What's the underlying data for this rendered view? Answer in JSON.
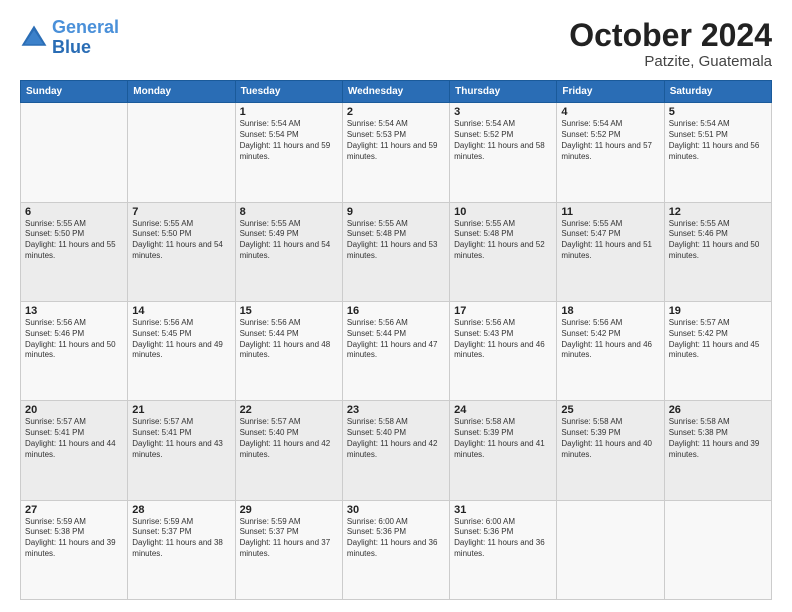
{
  "header": {
    "logo_line1": "General",
    "logo_line2": "Blue",
    "month": "October 2024",
    "location": "Patzite, Guatemala"
  },
  "weekdays": [
    "Sunday",
    "Monday",
    "Tuesday",
    "Wednesday",
    "Thursday",
    "Friday",
    "Saturday"
  ],
  "weeks": [
    [
      {
        "day": "",
        "sunrise": "",
        "sunset": "",
        "daylight": ""
      },
      {
        "day": "",
        "sunrise": "",
        "sunset": "",
        "daylight": ""
      },
      {
        "day": "1",
        "sunrise": "Sunrise: 5:54 AM",
        "sunset": "Sunset: 5:54 PM",
        "daylight": "Daylight: 11 hours and 59 minutes."
      },
      {
        "day": "2",
        "sunrise": "Sunrise: 5:54 AM",
        "sunset": "Sunset: 5:53 PM",
        "daylight": "Daylight: 11 hours and 59 minutes."
      },
      {
        "day": "3",
        "sunrise": "Sunrise: 5:54 AM",
        "sunset": "Sunset: 5:52 PM",
        "daylight": "Daylight: 11 hours and 58 minutes."
      },
      {
        "day": "4",
        "sunrise": "Sunrise: 5:54 AM",
        "sunset": "Sunset: 5:52 PM",
        "daylight": "Daylight: 11 hours and 57 minutes."
      },
      {
        "day": "5",
        "sunrise": "Sunrise: 5:54 AM",
        "sunset": "Sunset: 5:51 PM",
        "daylight": "Daylight: 11 hours and 56 minutes."
      }
    ],
    [
      {
        "day": "6",
        "sunrise": "Sunrise: 5:55 AM",
        "sunset": "Sunset: 5:50 PM",
        "daylight": "Daylight: 11 hours and 55 minutes."
      },
      {
        "day": "7",
        "sunrise": "Sunrise: 5:55 AM",
        "sunset": "Sunset: 5:50 PM",
        "daylight": "Daylight: 11 hours and 54 minutes."
      },
      {
        "day": "8",
        "sunrise": "Sunrise: 5:55 AM",
        "sunset": "Sunset: 5:49 PM",
        "daylight": "Daylight: 11 hours and 54 minutes."
      },
      {
        "day": "9",
        "sunrise": "Sunrise: 5:55 AM",
        "sunset": "Sunset: 5:48 PM",
        "daylight": "Daylight: 11 hours and 53 minutes."
      },
      {
        "day": "10",
        "sunrise": "Sunrise: 5:55 AM",
        "sunset": "Sunset: 5:48 PM",
        "daylight": "Daylight: 11 hours and 52 minutes."
      },
      {
        "day": "11",
        "sunrise": "Sunrise: 5:55 AM",
        "sunset": "Sunset: 5:47 PM",
        "daylight": "Daylight: 11 hours and 51 minutes."
      },
      {
        "day": "12",
        "sunrise": "Sunrise: 5:55 AM",
        "sunset": "Sunset: 5:46 PM",
        "daylight": "Daylight: 11 hours and 50 minutes."
      }
    ],
    [
      {
        "day": "13",
        "sunrise": "Sunrise: 5:56 AM",
        "sunset": "Sunset: 5:46 PM",
        "daylight": "Daylight: 11 hours and 50 minutes."
      },
      {
        "day": "14",
        "sunrise": "Sunrise: 5:56 AM",
        "sunset": "Sunset: 5:45 PM",
        "daylight": "Daylight: 11 hours and 49 minutes."
      },
      {
        "day": "15",
        "sunrise": "Sunrise: 5:56 AM",
        "sunset": "Sunset: 5:44 PM",
        "daylight": "Daylight: 11 hours and 48 minutes."
      },
      {
        "day": "16",
        "sunrise": "Sunrise: 5:56 AM",
        "sunset": "Sunset: 5:44 PM",
        "daylight": "Daylight: 11 hours and 47 minutes."
      },
      {
        "day": "17",
        "sunrise": "Sunrise: 5:56 AM",
        "sunset": "Sunset: 5:43 PM",
        "daylight": "Daylight: 11 hours and 46 minutes."
      },
      {
        "day": "18",
        "sunrise": "Sunrise: 5:56 AM",
        "sunset": "Sunset: 5:42 PM",
        "daylight": "Daylight: 11 hours and 46 minutes."
      },
      {
        "day": "19",
        "sunrise": "Sunrise: 5:57 AM",
        "sunset": "Sunset: 5:42 PM",
        "daylight": "Daylight: 11 hours and 45 minutes."
      }
    ],
    [
      {
        "day": "20",
        "sunrise": "Sunrise: 5:57 AM",
        "sunset": "Sunset: 5:41 PM",
        "daylight": "Daylight: 11 hours and 44 minutes."
      },
      {
        "day": "21",
        "sunrise": "Sunrise: 5:57 AM",
        "sunset": "Sunset: 5:41 PM",
        "daylight": "Daylight: 11 hours and 43 minutes."
      },
      {
        "day": "22",
        "sunrise": "Sunrise: 5:57 AM",
        "sunset": "Sunset: 5:40 PM",
        "daylight": "Daylight: 11 hours and 42 minutes."
      },
      {
        "day": "23",
        "sunrise": "Sunrise: 5:58 AM",
        "sunset": "Sunset: 5:40 PM",
        "daylight": "Daylight: 11 hours and 42 minutes."
      },
      {
        "day": "24",
        "sunrise": "Sunrise: 5:58 AM",
        "sunset": "Sunset: 5:39 PM",
        "daylight": "Daylight: 11 hours and 41 minutes."
      },
      {
        "day": "25",
        "sunrise": "Sunrise: 5:58 AM",
        "sunset": "Sunset: 5:39 PM",
        "daylight": "Daylight: 11 hours and 40 minutes."
      },
      {
        "day": "26",
        "sunrise": "Sunrise: 5:58 AM",
        "sunset": "Sunset: 5:38 PM",
        "daylight": "Daylight: 11 hours and 39 minutes."
      }
    ],
    [
      {
        "day": "27",
        "sunrise": "Sunrise: 5:59 AM",
        "sunset": "Sunset: 5:38 PM",
        "daylight": "Daylight: 11 hours and 39 minutes."
      },
      {
        "day": "28",
        "sunrise": "Sunrise: 5:59 AM",
        "sunset": "Sunset: 5:37 PM",
        "daylight": "Daylight: 11 hours and 38 minutes."
      },
      {
        "day": "29",
        "sunrise": "Sunrise: 5:59 AM",
        "sunset": "Sunset: 5:37 PM",
        "daylight": "Daylight: 11 hours and 37 minutes."
      },
      {
        "day": "30",
        "sunrise": "Sunrise: 6:00 AM",
        "sunset": "Sunset: 5:36 PM",
        "daylight": "Daylight: 11 hours and 36 minutes."
      },
      {
        "day": "31",
        "sunrise": "Sunrise: 6:00 AM",
        "sunset": "Sunset: 5:36 PM",
        "daylight": "Daylight: 11 hours and 36 minutes."
      },
      {
        "day": "",
        "sunrise": "",
        "sunset": "",
        "daylight": ""
      },
      {
        "day": "",
        "sunrise": "",
        "sunset": "",
        "daylight": ""
      }
    ]
  ]
}
